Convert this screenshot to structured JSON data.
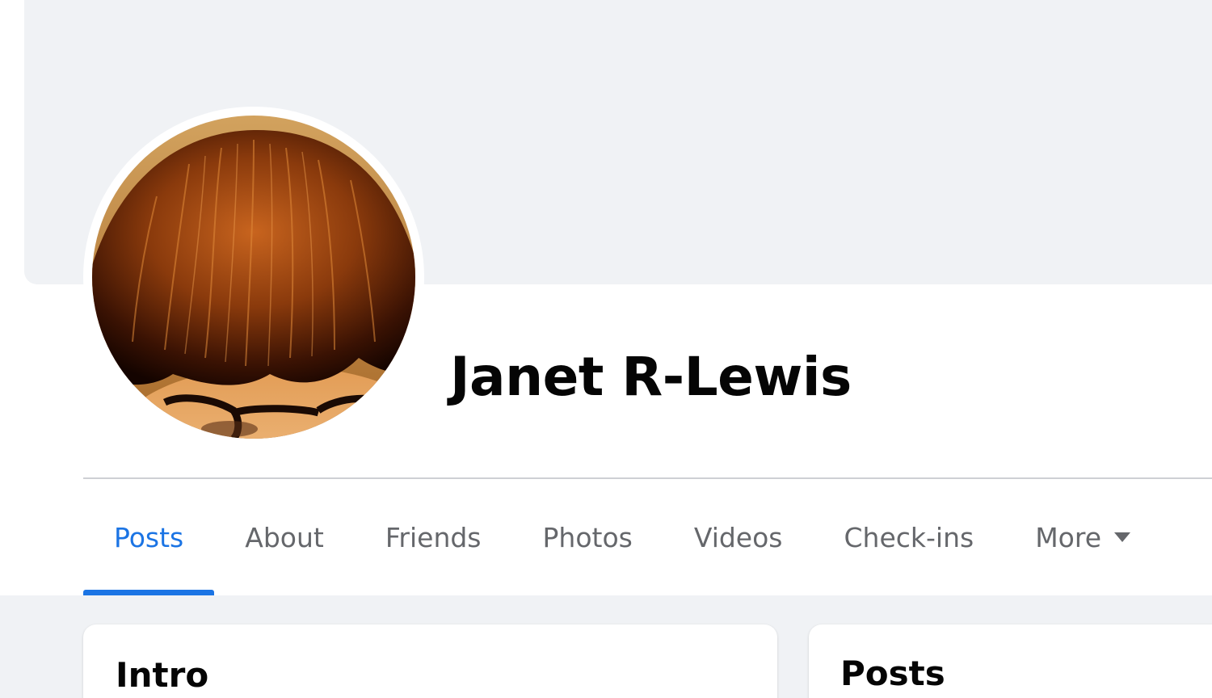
{
  "profile": {
    "name": "Janet R-Lewis"
  },
  "tabs": [
    {
      "label": "Posts",
      "active": true
    },
    {
      "label": "About",
      "active": false
    },
    {
      "label": "Friends",
      "active": false
    },
    {
      "label": "Photos",
      "active": false
    },
    {
      "label": "Videos",
      "active": false
    },
    {
      "label": "Check-ins",
      "active": false
    },
    {
      "label": "More",
      "active": false,
      "icon": "caret-down-icon"
    }
  ],
  "cards": {
    "intro_title": "Intro",
    "posts_title": "Posts"
  },
  "colors": {
    "accent": "#1b74e4",
    "cover_background": "#f0f2f5",
    "tab_inactive": "#65676b",
    "text_primary": "#050505"
  }
}
